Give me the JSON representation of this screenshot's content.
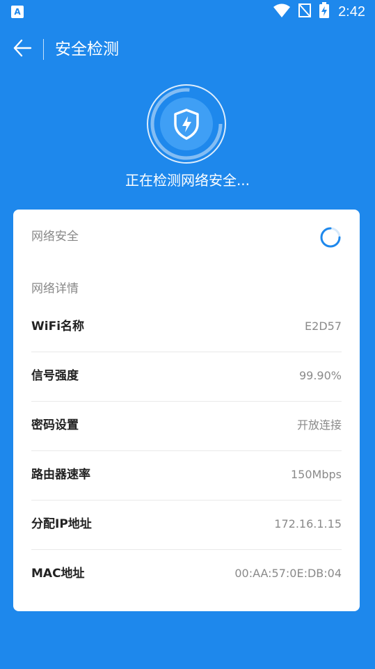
{
  "status_bar": {
    "time": "2:42",
    "app_icon_letter": "A"
  },
  "toolbar": {
    "title": "安全检测"
  },
  "scan": {
    "status_text": "正在检测网络安全..."
  },
  "card": {
    "security_label": "网络安全",
    "details_label": "网络详情",
    "details": [
      {
        "key": "WiFi名称",
        "value": "E2D57"
      },
      {
        "key": "信号强度",
        "value": "99.90%"
      },
      {
        "key": "密码设置",
        "value": "开放连接"
      },
      {
        "key": "路由器速率",
        "value": "150Mbps"
      },
      {
        "key": "分配IP地址",
        "value": "172.16.1.15"
      },
      {
        "key": "MAC地址",
        "value": "00:AA:57:0E:DB:04"
      }
    ]
  },
  "colors": {
    "background": "#1e88ec",
    "card": "#ffffff",
    "accent": "#1e88ec"
  }
}
